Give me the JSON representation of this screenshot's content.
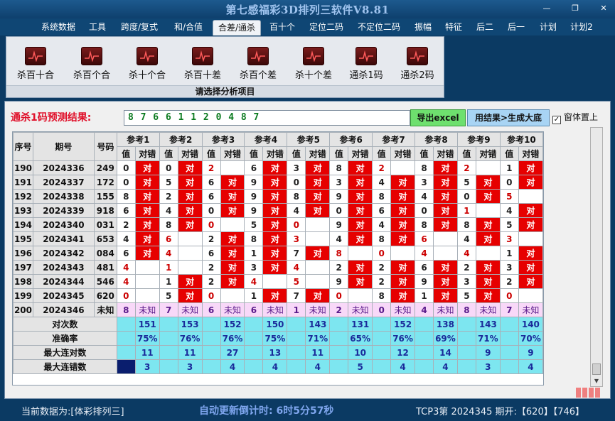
{
  "app": {
    "title": "第七感福彩3D排列三软件V8.81"
  },
  "window_controls": {
    "minimize": "—",
    "restore": "❐",
    "close": "✕"
  },
  "menu": [
    "系统数据",
    "工具",
    "跨度/复式",
    "和/合值",
    "合差/通杀",
    "百十个",
    "定位二码",
    "不定位二码",
    "振幅",
    "特征",
    "后二",
    "后一",
    "计划",
    "计划2"
  ],
  "menu_active": "合差/通杀",
  "ribbon": {
    "tools": [
      "杀百十合",
      "杀百个合",
      "杀十个合",
      "杀百十差",
      "杀百个差",
      "杀十个差",
      "通杀1码",
      "通杀2码"
    ],
    "caption": "请选择分析项目"
  },
  "prediction": {
    "label": "通杀1码预测结果:",
    "result": "8 7 6 6 1 1 2 0 4 8 7",
    "export_label": "导出excel",
    "generate_label": "用结果>生成大底",
    "topmost_label": "窗体置上",
    "topmost_checked": "✓"
  },
  "table": {
    "headers": {
      "idx": "序号",
      "period": "期号",
      "num": "号码"
    },
    "ref_headers": [
      "参考1",
      "参考2",
      "参考3",
      "参考4",
      "参考5",
      "参考6",
      "参考7",
      "参考8",
      "参考9",
      "参考10"
    ],
    "sub_value": "值",
    "sub_result": "对错",
    "result_hit": "对",
    "rows": [
      {
        "idx": "190",
        "period": "2024336",
        "num": "249",
        "vals": [
          "0",
          "0",
          "2",
          "6",
          "3",
          "8",
          "2",
          "8",
          "2",
          "1"
        ],
        "hits": [
          true,
          true,
          false,
          true,
          true,
          true,
          false,
          true,
          false,
          true
        ]
      },
      {
        "idx": "191",
        "period": "2024337",
        "num": "172",
        "vals": [
          "0",
          "5",
          "6",
          "9",
          "0",
          "3",
          "4",
          "3",
          "5",
          "0"
        ],
        "hits": [
          true,
          true,
          true,
          true,
          true,
          true,
          true,
          true,
          true,
          true
        ]
      },
      {
        "idx": "192",
        "period": "2024338",
        "num": "155",
        "vals": [
          "8",
          "2",
          "6",
          "9",
          "8",
          "9",
          "8",
          "4",
          "0",
          "5"
        ],
        "hits": [
          true,
          true,
          true,
          true,
          true,
          true,
          true,
          true,
          true,
          false
        ]
      },
      {
        "idx": "193",
        "period": "2024339",
        "num": "918",
        "vals": [
          "6",
          "4",
          "0",
          "9",
          "4",
          "0",
          "6",
          "0",
          "1",
          "4"
        ],
        "hits": [
          true,
          true,
          true,
          true,
          true,
          true,
          true,
          true,
          false,
          true
        ]
      },
      {
        "idx": "194",
        "period": "2024340",
        "num": "031",
        "vals": [
          "2",
          "8",
          "0",
          "5",
          "0",
          "9",
          "4",
          "8",
          "8",
          "5"
        ],
        "hits": [
          true,
          true,
          false,
          true,
          false,
          true,
          true,
          true,
          true,
          true
        ]
      },
      {
        "idx": "195",
        "period": "2024341",
        "num": "653",
        "vals": [
          "4",
          "6",
          "2",
          "8",
          "3",
          "4",
          "8",
          "6",
          "4",
          "3"
        ],
        "hits": [
          true,
          false,
          true,
          true,
          false,
          true,
          true,
          false,
          true,
          false
        ]
      },
      {
        "idx": "196",
        "period": "2024342",
        "num": "084",
        "vals": [
          "6",
          "4",
          "6",
          "1",
          "7",
          "8",
          "0",
          "4",
          "4",
          "1"
        ],
        "hits": [
          true,
          false,
          true,
          true,
          true,
          false,
          false,
          false,
          false,
          true
        ]
      },
      {
        "idx": "197",
        "period": "2024343",
        "num": "481",
        "vals": [
          "4",
          "1",
          "2",
          "3",
          "4",
          "2",
          "2",
          "6",
          "2",
          "3"
        ],
        "hits": [
          false,
          false,
          true,
          true,
          false,
          true,
          true,
          true,
          true,
          true
        ]
      },
      {
        "idx": "198",
        "period": "2024344",
        "num": "546",
        "vals": [
          "4",
          "1",
          "2",
          "4",
          "5",
          "9",
          "2",
          "9",
          "3",
          "2"
        ],
        "hits": [
          false,
          true,
          true,
          false,
          false,
          true,
          true,
          true,
          true,
          true
        ]
      },
      {
        "idx": "199",
        "period": "2024345",
        "num": "620",
        "vals": [
          "0",
          "5",
          "0",
          "1",
          "7",
          "0",
          "8",
          "1",
          "5",
          "0"
        ],
        "hits": [
          false,
          true,
          false,
          true,
          true,
          false,
          true,
          true,
          true,
          false
        ]
      }
    ],
    "pending": {
      "idx": "200",
      "period": "2024346",
      "num": "未知",
      "vals": [
        "8",
        "7",
        "6",
        "6",
        "1",
        "2",
        "0",
        "4",
        "8",
        "7"
      ],
      "label": "未知"
    },
    "stats": [
      {
        "label": "对次数",
        "vals": [
          "151",
          "153",
          "152",
          "150",
          "143",
          "131",
          "152",
          "138",
          "143",
          "140"
        ]
      },
      {
        "label": "准确率",
        "vals": [
          "75%",
          "76%",
          "76%",
          "75%",
          "71%",
          "65%",
          "76%",
          "69%",
          "71%",
          "70%"
        ]
      },
      {
        "label": "最大连对数",
        "vals": [
          "11",
          "11",
          "27",
          "13",
          "11",
          "10",
          "12",
          "14",
          "9",
          "9"
        ]
      },
      {
        "label": "最大连错数",
        "vals": [
          "3",
          "3",
          "4",
          "4",
          "4",
          "5",
          "4",
          "4",
          "3",
          "4"
        ]
      }
    ]
  },
  "status": {
    "current": "当前数据为:[体彩排列三]",
    "countdown": "自动更新倒计时: 6时5分57秒",
    "right": "TCP3第 2024345 期开:【620】【746】"
  },
  "colors": {
    "hit": "#e60000",
    "stats": "#7de6f0",
    "pending": "#f8d8f8",
    "accent": "#0b3a63"
  }
}
